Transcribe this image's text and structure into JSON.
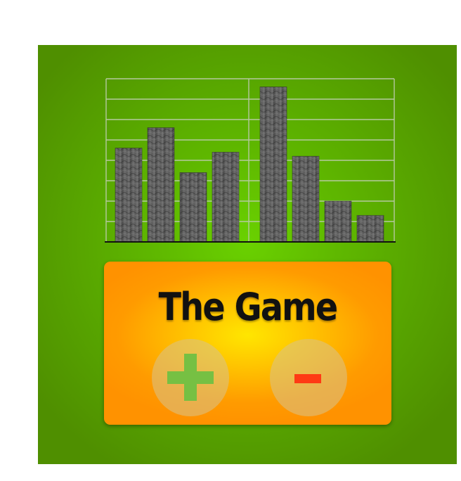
{
  "game": {
    "title": "The Game"
  },
  "colors": {
    "background_center": "#6ad100",
    "background_edge": "#4f8f00",
    "card_center": "#ffe600",
    "card_edge": "#ff9200",
    "plus": "#76c043",
    "minus": "#ff3a14",
    "bar": "#5a5a5a",
    "grid": "#b5c9a0"
  },
  "icons": {
    "plus": "plus-icon",
    "minus": "minus-icon"
  },
  "chart_data": {
    "type": "bar",
    "grid": true,
    "ylim": [
      0,
      8
    ],
    "groups": [
      {
        "values": [
          4.6,
          5.6,
          3.4,
          4.4
        ]
      },
      {
        "values": [
          7.6,
          4.2,
          2.0,
          1.3
        ]
      }
    ]
  }
}
